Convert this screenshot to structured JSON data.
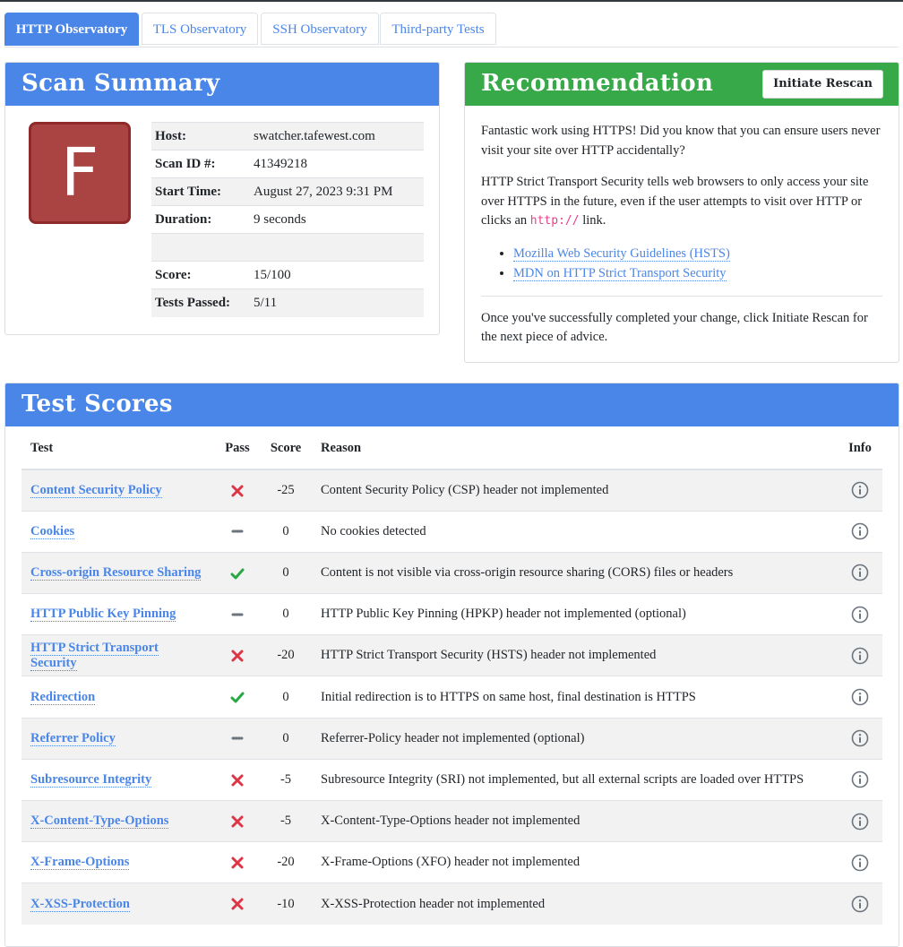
{
  "tabs": [
    {
      "label": "HTTP Observatory",
      "active": true
    },
    {
      "label": "TLS Observatory",
      "active": false
    },
    {
      "label": "SSH Observatory",
      "active": false
    },
    {
      "label": "Third-party Tests",
      "active": false
    }
  ],
  "summary": {
    "title": "Scan Summary",
    "grade": "F",
    "rows": [
      {
        "label": "Host:",
        "value": "swatcher.tafewest.com"
      },
      {
        "label": "Scan ID #:",
        "value": "41349218"
      },
      {
        "label": "Start Time:",
        "value": "August 27, 2023 9:31 PM"
      },
      {
        "label": "Duration:",
        "value": "9 seconds"
      },
      {
        "label": "",
        "value": ""
      },
      {
        "label": "Score:",
        "value": "15/100"
      },
      {
        "label": "Tests Passed:",
        "value": "5/11"
      }
    ]
  },
  "recommendation": {
    "title": "Recommendation",
    "rescan_label": "Initiate Rescan",
    "p1": "Fantastic work using HTTPS! Did you know that you can ensure users never visit your site over HTTP accidentally?",
    "p2_before": "HTTP Strict Transport Security tells web browsers to only access your site over HTTPS in the future, even if the user attempts to visit over HTTP or clicks an",
    "p2_code": "http://",
    "p2_after": "link.",
    "links": [
      "Mozilla Web Security Guidelines (HSTS)",
      "MDN on HTTP Strict Transport Security"
    ],
    "p3": "Once you've successfully completed your change, click Initiate Rescan for the next piece of advice."
  },
  "scores": {
    "title": "Test Scores",
    "headers": {
      "test": "Test",
      "pass": "Pass",
      "score": "Score",
      "reason": "Reason",
      "info": "Info"
    },
    "rows": [
      {
        "test": "Content Security Policy",
        "pass": "fail",
        "score": "-25",
        "reason": "Content Security Policy (CSP) header not implemented"
      },
      {
        "test": "Cookies",
        "pass": "neutral",
        "score": "0",
        "reason": "No cookies detected"
      },
      {
        "test": "Cross-origin Resource Sharing",
        "pass": "pass",
        "score": "0",
        "reason": "Content is not visible via cross-origin resource sharing (CORS) files or headers"
      },
      {
        "test": "HTTP Public Key Pinning",
        "pass": "neutral",
        "score": "0",
        "reason": "HTTP Public Key Pinning (HPKP) header not implemented (optional)"
      },
      {
        "test": "HTTP Strict Transport Security",
        "pass": "fail",
        "score": "-20",
        "reason": "HTTP Strict Transport Security (HSTS) header not implemented"
      },
      {
        "test": "Redirection",
        "pass": "pass",
        "score": "0",
        "reason": "Initial redirection is to HTTPS on same host, final destination is HTTPS"
      },
      {
        "test": "Referrer Policy",
        "pass": "neutral",
        "score": "0",
        "reason": "Referrer-Policy header not implemented (optional)"
      },
      {
        "test": "Subresource Integrity",
        "pass": "fail",
        "score": "-5",
        "reason": "Subresource Integrity (SRI) not implemented, but all external scripts are loaded over HTTPS"
      },
      {
        "test": "X-Content-Type-Options",
        "pass": "fail",
        "score": "-5",
        "reason": "X-Content-Type-Options header not implemented"
      },
      {
        "test": "X-Frame-Options",
        "pass": "fail",
        "score": "-20",
        "reason": "X-Frame-Options (XFO) header not implemented"
      },
      {
        "test": "X-XSS-Protection",
        "pass": "fail",
        "score": "-10",
        "reason": "X-XSS-Protection header not implemented"
      }
    ]
  },
  "icons": {
    "fail": "cross-icon",
    "pass": "check-icon",
    "neutral": "dash-icon",
    "info": "info-icon"
  },
  "colors": {
    "accent": "#4a86e8",
    "success": "#38a948",
    "grade_f": "#a94442",
    "fail": "#dc3545",
    "pass": "#28a745",
    "neutral": "#6c757d"
  }
}
